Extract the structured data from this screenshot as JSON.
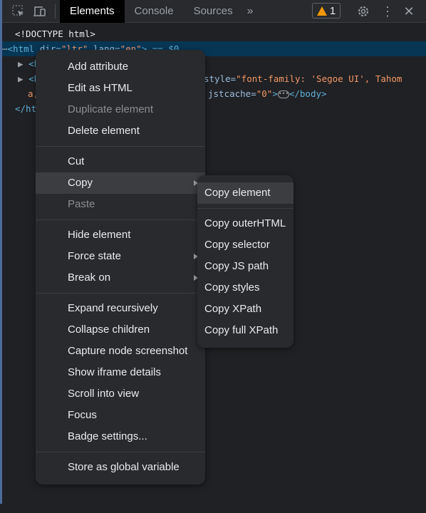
{
  "toolbar": {
    "tabs": [
      {
        "label": "Elements",
        "active": true
      },
      {
        "label": "Console"
      },
      {
        "label": "Sources"
      }
    ],
    "more_tabs_icon": "double-chevron-right",
    "warning_count": "1",
    "icons": [
      "inspect-element",
      "device-toolbar",
      "settings-gear",
      "more-vertical",
      "close"
    ]
  },
  "dom": {
    "doctype": "<!DOCTYPE html>",
    "html_open": [
      "<html",
      " dir=",
      "\"ltr\"",
      " lang=",
      "\"en\"",
      "> == $0"
    ],
    "head": "<h",
    "body_start": "<b",
    "body_style": [
      "style=",
      "\"font-family: 'Segoe UI', Tahom"
    ],
    "body_cont": "a,",
    "body_end": [
      "jstcache=",
      "\"0\"",
      ">",
      "</body>"
    ],
    "html_close": "</ht"
  },
  "context_menu": {
    "groups": [
      [
        {
          "label": "Add attribute"
        },
        {
          "label": "Edit as HTML"
        },
        {
          "label": "Duplicate element",
          "disabled": true
        },
        {
          "label": "Delete element"
        }
      ],
      [
        {
          "label": "Cut"
        },
        {
          "label": "Copy",
          "highlighted": true,
          "submenu": true
        },
        {
          "label": "Paste",
          "disabled": true
        }
      ],
      [
        {
          "label": "Hide element"
        },
        {
          "label": "Force state",
          "submenu": true
        },
        {
          "label": "Break on",
          "submenu": true
        }
      ],
      [
        {
          "label": "Expand recursively"
        },
        {
          "label": "Collapse children"
        },
        {
          "label": "Capture node screenshot"
        },
        {
          "label": "Show iframe details"
        },
        {
          "label": "Scroll into view"
        },
        {
          "label": "Focus"
        },
        {
          "label": "Badge settings..."
        }
      ],
      [
        {
          "label": "Store as global variable"
        }
      ]
    ]
  },
  "copy_submenu": {
    "groups": [
      [
        {
          "label": "Copy element",
          "highlighted": true
        }
      ],
      [
        {
          "label": "Copy outerHTML"
        },
        {
          "label": "Copy selector"
        },
        {
          "label": "Copy JS path"
        },
        {
          "label": "Copy styles"
        },
        {
          "label": "Copy XPath"
        },
        {
          "label": "Copy full XPath"
        }
      ]
    ]
  },
  "colors": {
    "background": "#202124",
    "selection": "#073655",
    "tag": "#5db0d7",
    "attr_value": "#f29766",
    "warning": "#f29900"
  }
}
